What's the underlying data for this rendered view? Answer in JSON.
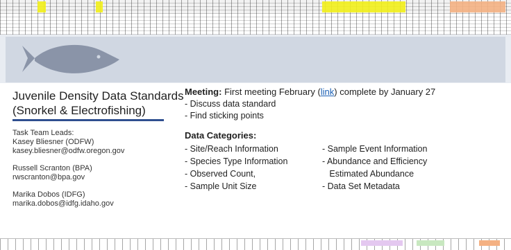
{
  "title": {
    "line1": "Juvenile Density Data Standards",
    "line2": "(Snorkel & Electrofishing)"
  },
  "leads": {
    "heading": "Task Team Leads:",
    "people": [
      {
        "name": "Kasey Bliesner (ODFW)",
        "email": "kasey.bliesner@odfw.oregon.gov"
      },
      {
        "name": "Russell Scranton (BPA)",
        "email": "rwscranton@bpa.gov"
      },
      {
        "name": "Marika Dobos (IDFG)",
        "email": "marika.dobos@idfg.idaho.gov"
      }
    ]
  },
  "meeting": {
    "label": "Meeting:",
    "pre": "First meeting February (",
    "link": "link",
    "post": ") complete by January 27",
    "bullets": [
      "-  Discuss data standard",
      "-  Find sticking points"
    ]
  },
  "categories": {
    "title": "Data Categories:",
    "col1": [
      "- Site/Reach Information",
      "- Species Type Information",
      "-  Observed Count,",
      "- Sample Unit Size"
    ],
    "col2": [
      "- Sample Event Information",
      "- Abundance and Efficiency",
      "   Estimated Abundance",
      "- Data Set Metadata"
    ]
  },
  "colors": {
    "accent_rule": "#2f4f8f",
    "fish": "#8a94a8",
    "link": "#1a5fb4",
    "highlight_yellow": "#f2ef1a"
  },
  "icons": {
    "banner": "fish-icon"
  }
}
